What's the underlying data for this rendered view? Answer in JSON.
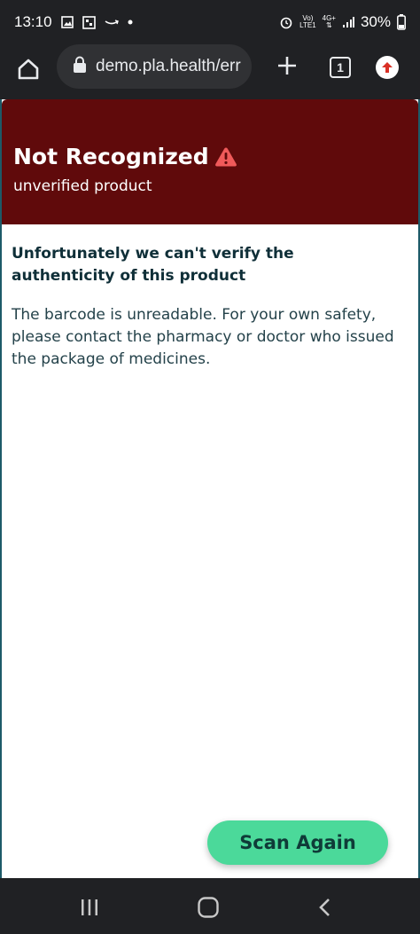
{
  "status_bar": {
    "time": "13:10",
    "battery": "30%",
    "network_top": "Vo)",
    "network_bottom": "LTE1",
    "signal_label_top": "4G+"
  },
  "browser": {
    "url": "demo.pla.health/err",
    "tab_count": "1"
  },
  "banner": {
    "title": "Not Recognized",
    "subtitle": "unverified product",
    "background_color": "#600a0b",
    "warning_icon": "warning-icon"
  },
  "content": {
    "heading": "Unfortunately we can't verify the authenticity of this product",
    "body": "The barcode is unreadable. For your own safety, please contact the pharmacy or doctor who issued the package of medicines."
  },
  "actions": {
    "scan_again_label": "Scan Again",
    "scan_again_color": "#4bd99a"
  },
  "nav": {
    "icons": [
      "recent-apps-icon",
      "home-icon",
      "back-icon"
    ]
  }
}
